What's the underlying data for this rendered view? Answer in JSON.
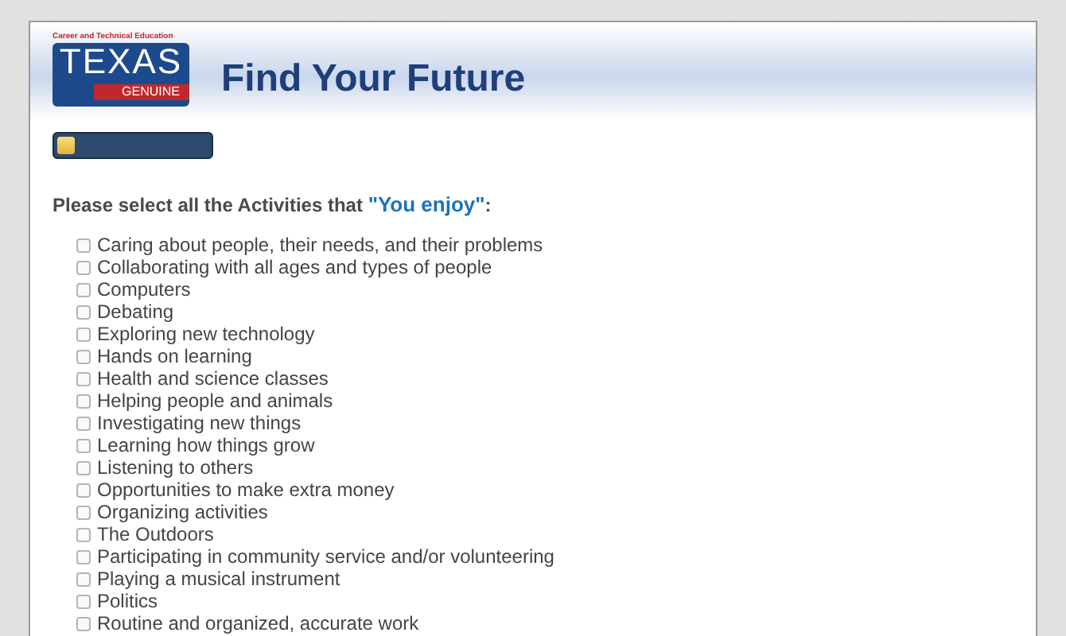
{
  "header": {
    "logo": {
      "tagline": "Career and Technical Education",
      "wordmark": "TEXAS",
      "subword": "GENUINE"
    },
    "title": "Find Your Future"
  },
  "progress": {
    "level": 0.12
  },
  "question": "Please select all the Activities that **\"You enjoy\"**:",
  "activities": [
    {
      "label": "Caring about people, their needs, and their problems",
      "checked": false
    },
    {
      "label": "Collaborating with all ages and types of people",
      "checked": false
    },
    {
      "label": "Computers",
      "checked": false
    },
    {
      "label": "Debating",
      "checked": false
    },
    {
      "label": "Exploring new technology",
      "checked": false
    },
    {
      "label": "Hands on learning",
      "checked": false
    },
    {
      "label": "Health and science classes",
      "checked": false
    },
    {
      "label": "Helping people and animals",
      "checked": false
    },
    {
      "label": "Investigating new things",
      "checked": false
    },
    {
      "label": "Learning how things grow",
      "checked": false
    },
    {
      "label": "Listening to others",
      "checked": false
    },
    {
      "label": "Opportunities to make extra money",
      "checked": false
    },
    {
      "label": "Organizing activities",
      "checked": false
    },
    {
      "label": "The Outdoors",
      "checked": false
    },
    {
      "label": "Participating in community service and/or volunteering",
      "checked": false
    },
    {
      "label": "Playing a musical instrument",
      "checked": false
    },
    {
      "label": "Politics",
      "checked": false
    },
    {
      "label": "Routine and organized, accurate work",
      "checked": false
    }
  ]
}
